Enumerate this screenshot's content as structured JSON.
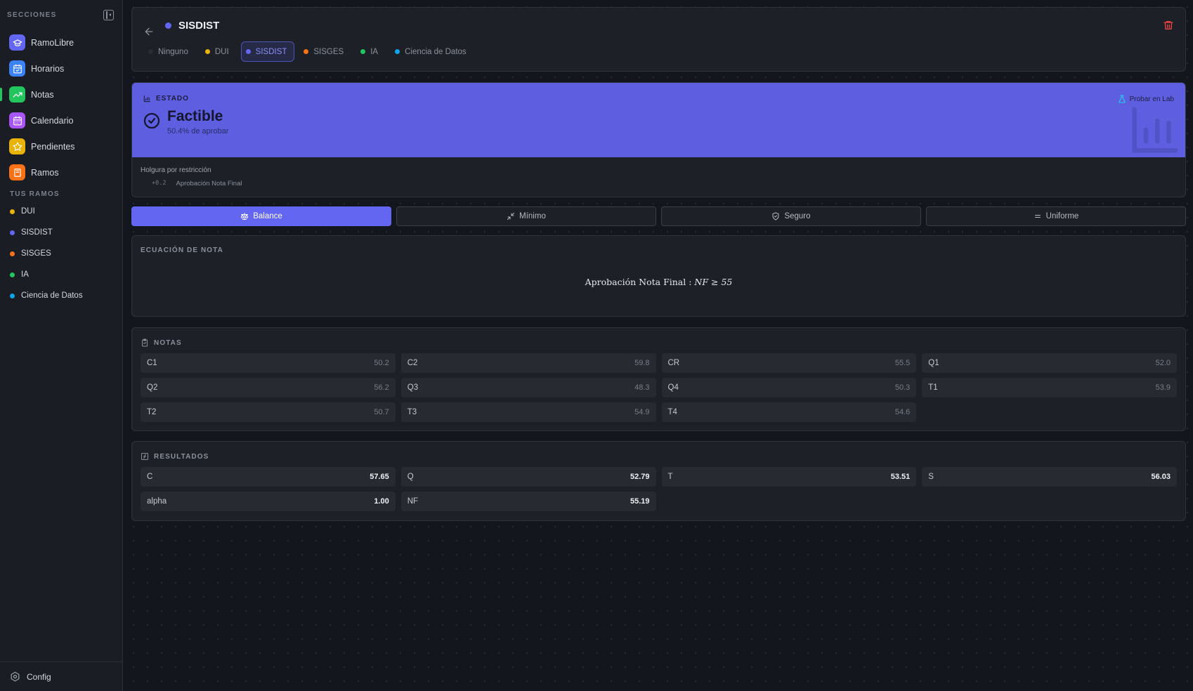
{
  "sidebar": {
    "section_label": "SECCIONES",
    "items": [
      {
        "label": "RamoLibre",
        "icon": "graduation-cap-icon",
        "color": "#6366f1"
      },
      {
        "label": "Horarios",
        "icon": "calendar-clock-icon",
        "color": "#3b82f6"
      },
      {
        "label": "Notas",
        "icon": "trending-up-icon",
        "color": "#22c55e"
      },
      {
        "label": "Calendario",
        "icon": "calendar-icon",
        "color": "#a855f7"
      },
      {
        "label": "Pendientes",
        "icon": "star-icon",
        "color": "#eab308"
      },
      {
        "label": "Ramos",
        "icon": "book-icon",
        "color": "#f97316"
      }
    ],
    "ramos_label": "TUS RAMOS",
    "ramos": [
      {
        "label": "DUI",
        "color": "#eab308"
      },
      {
        "label": "SISDIST",
        "color": "#6366f1"
      },
      {
        "label": "SISGES",
        "color": "#f97316"
      },
      {
        "label": "IA",
        "color": "#22c55e"
      },
      {
        "label": "Ciencia de Datos",
        "color": "#0ea5e9"
      }
    ],
    "footer_label": "Config"
  },
  "header": {
    "title": "SISDIST",
    "title_color": "#6366f1",
    "tabs": [
      {
        "label": "Ninguno",
        "color": "#2a2d33"
      },
      {
        "label": "DUI",
        "color": "#eab308"
      },
      {
        "label": "SISDIST",
        "color": "#6366f1",
        "active": true
      },
      {
        "label": "SISGES",
        "color": "#f97316"
      },
      {
        "label": "IA",
        "color": "#22c55e"
      },
      {
        "label": "Ciencia de Datos",
        "color": "#0ea5e9"
      }
    ]
  },
  "estado": {
    "label": "ESTADO",
    "status": "Factible",
    "subtitle": "50.4% de aprobar",
    "lab_button": "Probar en Lab",
    "holgura_label": "Holgura por restricción",
    "holgura": [
      {
        "value": "+0.2",
        "name": "Aprobación Nota Final"
      }
    ]
  },
  "modes": {
    "items": [
      {
        "label": "Balance",
        "icon": "scale-icon",
        "active": true
      },
      {
        "label": "Mínimo",
        "icon": "minimize-icon"
      },
      {
        "label": "Seguro",
        "icon": "shield-icon"
      },
      {
        "label": "Uniforme",
        "icon": "equals-icon"
      }
    ]
  },
  "ecuacion": {
    "label": "ECUACIÓN DE NOTA",
    "text": "Aprobación Nota Final :",
    "math": "NF ≥ 55"
  },
  "notas": {
    "label": "NOTAS",
    "items": [
      {
        "key": "C1",
        "value": "50.2"
      },
      {
        "key": "C2",
        "value": "59.8"
      },
      {
        "key": "CR",
        "value": "55.5"
      },
      {
        "key": "Q1",
        "value": "52.0"
      },
      {
        "key": "Q2",
        "value": "56.2"
      },
      {
        "key": "Q3",
        "value": "48.3"
      },
      {
        "key": "Q4",
        "value": "50.3"
      },
      {
        "key": "T1",
        "value": "53.9"
      },
      {
        "key": "T2",
        "value": "50.7"
      },
      {
        "key": "T3",
        "value": "54.9"
      },
      {
        "key": "T4",
        "value": "54.6"
      }
    ]
  },
  "resultados": {
    "label": "RESULTADOS",
    "items": [
      {
        "key": "C",
        "value": "57.65"
      },
      {
        "key": "Q",
        "value": "52.79"
      },
      {
        "key": "T",
        "value": "53.51"
      },
      {
        "key": "S",
        "value": "56.03"
      },
      {
        "key": "alpha",
        "value": "1.00"
      },
      {
        "key": "NF",
        "value": "55.19"
      }
    ]
  }
}
